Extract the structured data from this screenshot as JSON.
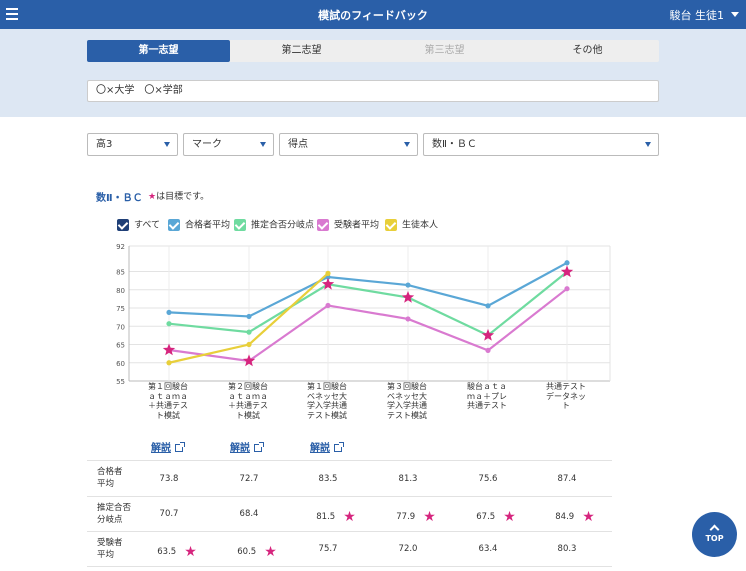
{
  "header": {
    "title": "模試のフィードバック",
    "user": "駿台 生徒1"
  },
  "tabs": [
    {
      "label": "第一志望",
      "state": "active"
    },
    {
      "label": "第二志望",
      "state": "normal"
    },
    {
      "label": "第三志望",
      "state": "disabled"
    },
    {
      "label": "その他",
      "state": "normal"
    }
  ],
  "school": "〇×大学　〇×学部",
  "filters": {
    "grade": "高3",
    "type": "マーク",
    "metric": "得点",
    "subject": "数Ⅱ・ＢＣ"
  },
  "subject_title": "数Ⅱ・ＢＣ",
  "subject_note_star": "★",
  "subject_note": "は目標です。",
  "legend": [
    {
      "label": "すべて",
      "color": "#1f3f77"
    },
    {
      "label": "合格者平均",
      "color": "#5aa7d6"
    },
    {
      "label": "推定合否分岐点",
      "color": "#6fdba0"
    },
    {
      "label": "受験者平均",
      "color": "#d97ad0"
    },
    {
      "label": "生徒本人",
      "color": "#e8cf3a"
    }
  ],
  "chart_data": {
    "type": "line",
    "categories": [
      "第１回駿台\nａｔａｍａ\n＋共通テス\nト模試",
      "第２回駿台\nａｔａｍａ\n＋共通テス\nト模試",
      "第１回駿台\nベネッセ大\n学入学共通\nテスト模試",
      "第３回駿台\nベネッセ大\n学入学共通\nテスト模試",
      "駿台ａｔａ\nｍａ＋プレ\n共通テスト",
      "共通テスト\nデータネッ\nト"
    ],
    "ylim": [
      55,
      92
    ],
    "yticks": [
      55,
      60,
      65,
      70,
      75,
      80,
      85,
      92
    ],
    "grid": true,
    "series": [
      {
        "name": "合格者平均",
        "color": "#5aa7d6",
        "values": [
          73.8,
          72.7,
          83.5,
          81.3,
          75.6,
          87.4
        ]
      },
      {
        "name": "推定合否分岐点",
        "color": "#6fdba0",
        "values": [
          70.7,
          68.4,
          81.5,
          77.9,
          67.5,
          84.9
        ]
      },
      {
        "name": "受験者平均",
        "color": "#d97ad0",
        "values": [
          63.5,
          60.5,
          75.7,
          72.0,
          63.4,
          80.3
        ]
      },
      {
        "name": "生徒本人",
        "color": "#e8cf3a",
        "values": [
          60,
          65,
          84.5,
          null,
          null,
          null
        ]
      }
    ],
    "targets": [
      63.5,
      60.5,
      81.5,
      77.9,
      67.5,
      84.9
    ],
    "target_color": "#d6257e"
  },
  "links": [
    "解説",
    "解説",
    "解説"
  ],
  "table": [
    {
      "label": "合格者\n平均",
      "values": [
        "73.8",
        "72.7",
        "83.5",
        "81.3",
        "75.6",
        "87.4"
      ],
      "stars": [
        false,
        false,
        false,
        false,
        false,
        false
      ]
    },
    {
      "label": "推定合否\n分岐点",
      "values": [
        "70.7",
        "68.4",
        "81.5",
        "77.9",
        "67.5",
        "84.9"
      ],
      "stars": [
        false,
        false,
        true,
        true,
        true,
        true
      ]
    },
    {
      "label": "受験者\n平均",
      "values": [
        "63.5",
        "60.5",
        "75.7",
        "72.0",
        "63.4",
        "80.3"
      ],
      "stars": [
        true,
        true,
        false,
        false,
        false,
        false
      ]
    }
  ],
  "star_glyph": "★",
  "top_button": "TOP",
  "colors": {
    "brand": "#2a5fa8",
    "band": "#dde7f3",
    "target": "#d6257e"
  }
}
